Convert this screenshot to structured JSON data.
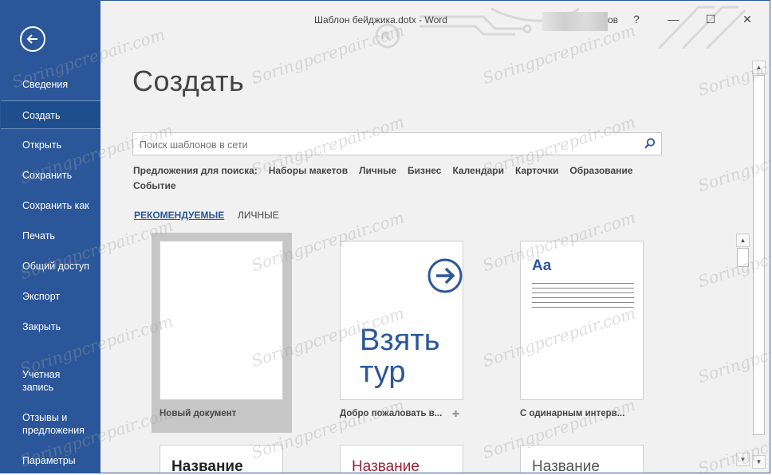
{
  "window": {
    "title": "Шаблон бейджика.dotx  -  Word",
    "user_suffix": "ов",
    "help": "?",
    "minimize": "—",
    "maximize": "☐",
    "close": "✕"
  },
  "sidebar": {
    "back_icon": "back-arrow-icon",
    "items": [
      {
        "label": "Сведения",
        "active": false
      },
      {
        "label": "Создать",
        "active": true
      },
      {
        "label": "Открыть",
        "active": false
      },
      {
        "label": "Сохранить",
        "active": false
      },
      {
        "label": "Сохранить как",
        "active": false
      },
      {
        "label": "Печать",
        "active": false
      },
      {
        "label": "Общий доступ",
        "active": false
      },
      {
        "label": "Экспорт",
        "active": false
      },
      {
        "label": "Закрыть",
        "active": false
      },
      {
        "label_line1": "Учетная",
        "label_line2": "запись",
        "active": false
      },
      {
        "label_line1": "Отзывы и",
        "label_line2": "предложения",
        "active": false
      },
      {
        "label": "Параметры",
        "active": false
      }
    ]
  },
  "main": {
    "heading": "Создать",
    "search": {
      "placeholder": "Поиск шаблонов в сети",
      "value": ""
    },
    "suggestions": {
      "label": "Предложения для поиска:",
      "links": [
        "Наборы макетов",
        "Личные",
        "Бизнес",
        "Календари",
        "Карточки",
        "Образование",
        "Событие"
      ]
    },
    "tabs": [
      {
        "label": "РЕКОМЕНДУЕМЫЕ",
        "active": true
      },
      {
        "label": "ЛИЧНЫЕ",
        "active": false
      }
    ],
    "templates": [
      {
        "caption": "Новый документ"
      },
      {
        "caption": "Добро пожаловать в...",
        "tour_line1": "Взять",
        "tour_line2": "тур"
      },
      {
        "caption": "С одинарным интерв...",
        "thumb_text": "Aa"
      }
    ],
    "bottom_templates": [
      "Название",
      "Название",
      "Название"
    ]
  },
  "watermark": "Soringpcrepair.com",
  "colors": {
    "accent": "#2b579a",
    "sidebar_active": "#1e4e8c",
    "background": "#f1f1f1"
  }
}
